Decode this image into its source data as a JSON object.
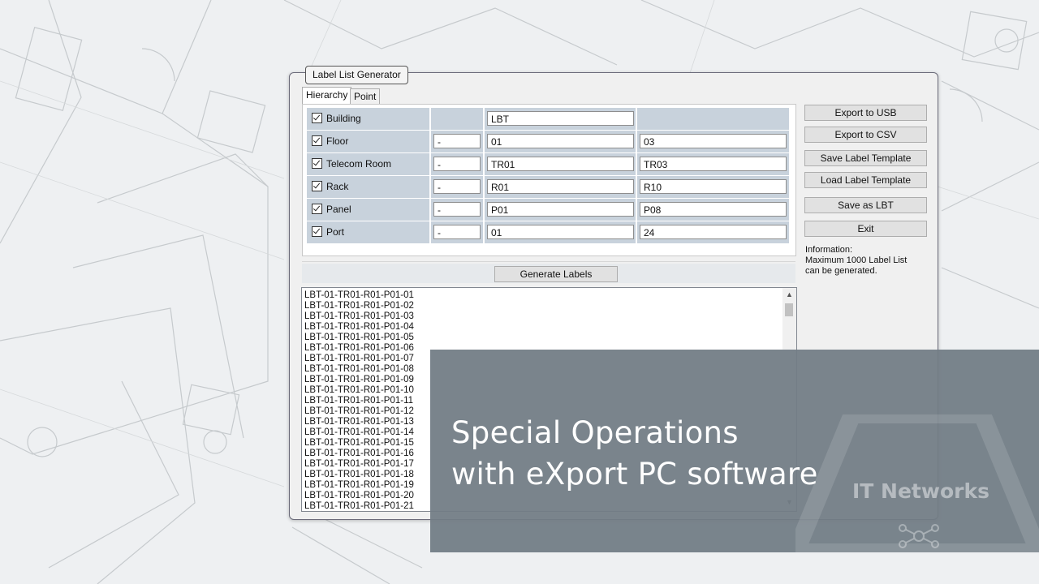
{
  "window": {
    "title": "Label List Generator",
    "tabs": [
      {
        "label": "Hierarchy",
        "active": true
      },
      {
        "label": "Point to Point",
        "active": false
      }
    ]
  },
  "hierarchy": [
    {
      "label": "Building",
      "checked": true,
      "separator": "",
      "from": "LBT",
      "to": ""
    },
    {
      "label": "Floor",
      "checked": true,
      "separator": "-",
      "from": "01",
      "to": "03"
    },
    {
      "label": "Telecom Room",
      "checked": true,
      "separator": "-",
      "from": "TR01",
      "to": "TR03"
    },
    {
      "label": "Rack",
      "checked": true,
      "separator": "-",
      "from": "R01",
      "to": "R10"
    },
    {
      "label": "Panel",
      "checked": true,
      "separator": "-",
      "from": "P01",
      "to": "P08"
    },
    {
      "label": "Port",
      "checked": true,
      "separator": "-",
      "from": "01",
      "to": "24"
    }
  ],
  "buttons": {
    "export_usb": "Export to USB",
    "export_csv": "Export to CSV",
    "save_template": "Save Label Template",
    "load_template": "Load Label Template",
    "save_lbt": "Save as LBT",
    "exit": "Exit",
    "generate": "Generate Labels"
  },
  "info": {
    "line1": "Information:",
    "line2": "Maximum 1000 Label List",
    "line3": "can be generated."
  },
  "label_list": [
    "LBT-01-TR01-R01-P01-01",
    "LBT-01-TR01-R01-P01-02",
    "LBT-01-TR01-R01-P01-03",
    "LBT-01-TR01-R01-P01-04",
    "LBT-01-TR01-R01-P01-05",
    "LBT-01-TR01-R01-P01-06",
    "LBT-01-TR01-R01-P01-07",
    "LBT-01-TR01-R01-P01-08",
    "LBT-01-TR01-R01-P01-09",
    "LBT-01-TR01-R01-P01-10",
    "LBT-01-TR01-R01-P01-11",
    "LBT-01-TR01-R01-P01-12",
    "LBT-01-TR01-R01-P01-13",
    "LBT-01-TR01-R01-P01-14",
    "LBT-01-TR01-R01-P01-15",
    "LBT-01-TR01-R01-P01-16",
    "LBT-01-TR01-R01-P01-17",
    "LBT-01-TR01-R01-P01-18",
    "LBT-01-TR01-R01-P01-19",
    "LBT-01-TR01-R01-P01-20",
    "LBT-01-TR01-R01-P01-21"
  ],
  "banner": {
    "line1": "Special Operations",
    "line2": "with eXport PC software",
    "brand": "IT Networks"
  },
  "colors": {
    "banner_bg": "#727c85",
    "row_bg": "#c8d2dc",
    "window_bg": "#f0f0f0"
  }
}
